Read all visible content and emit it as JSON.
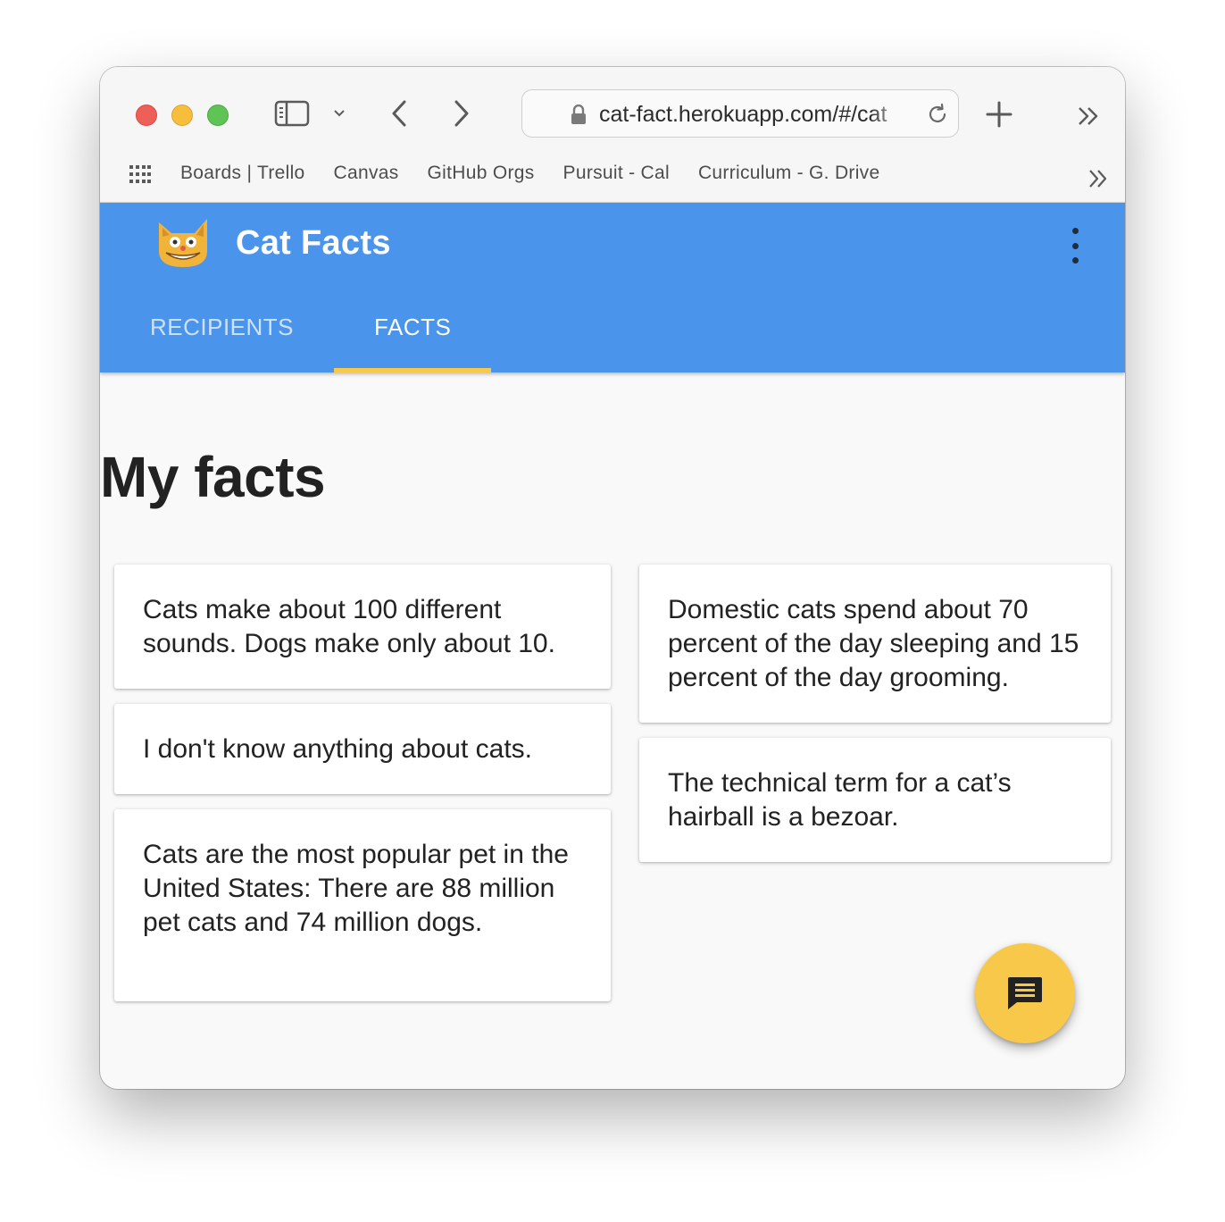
{
  "browser": {
    "url": "cat-fact.herokuapp.com/#/cat",
    "bookmarks": [
      "Boards | Trello",
      "Canvas",
      "GitHub Orgs",
      "Pursuit - Cal",
      "Curriculum - G. Drive"
    ]
  },
  "app": {
    "title": "Cat Facts",
    "tabs": [
      {
        "label": "RECIPIENTS",
        "active": false
      },
      {
        "label": "FACTS",
        "active": true
      }
    ],
    "accent_color": "#4a95eb",
    "highlight_color": "#f7c84a"
  },
  "main": {
    "heading": "My facts",
    "facts": [
      "Cats make about 100 different sounds. Dogs make only about 10.",
      "I don't know anything about cats.",
      "Cats are the most popular pet in the United States: There are 88 million pet cats and 74 million dogs.",
      "Domestic cats spend about 70 percent of the day sleeping and 15 percent of the day grooming.",
      "The technical term for a cat’s hairball is a bezoar."
    ]
  },
  "icons": {
    "fab": "chat-message-icon",
    "menu": "more-vert-icon",
    "logo": "cat-logo-icon"
  }
}
